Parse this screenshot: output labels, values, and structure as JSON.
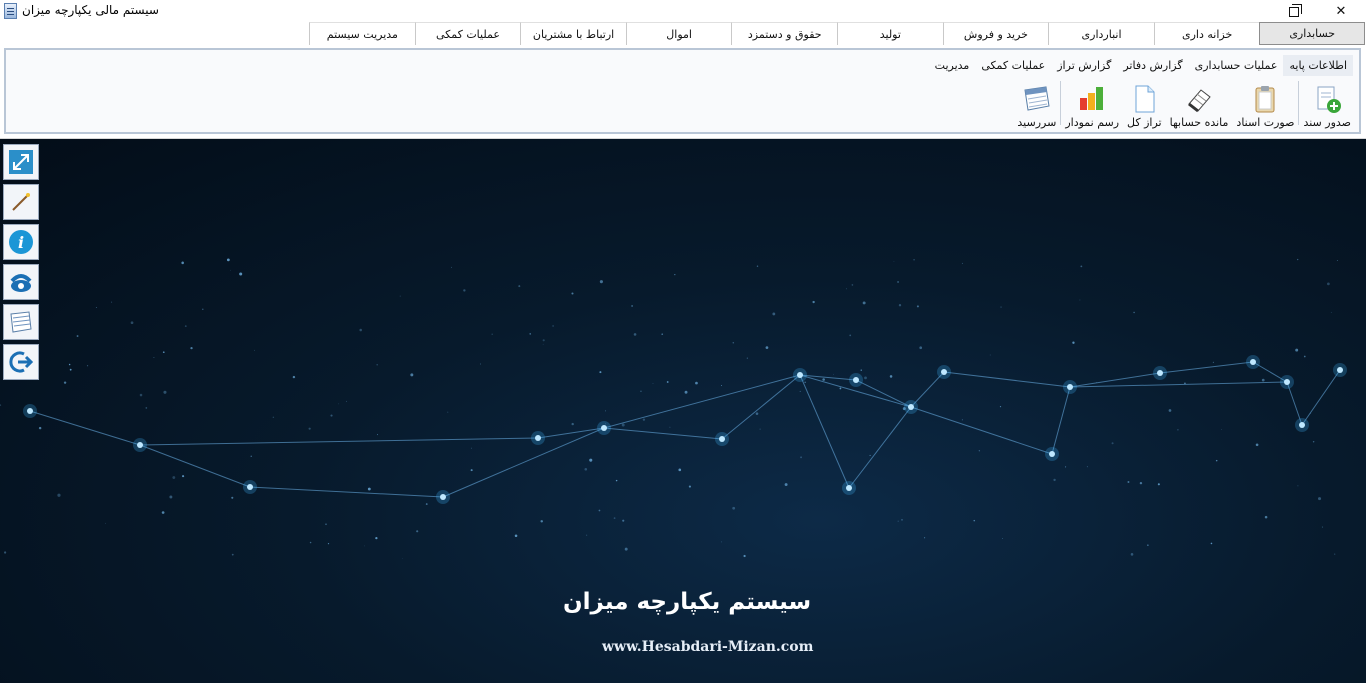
{
  "window": {
    "title": "سیستم مالی یکپارچه میزان"
  },
  "main_tabs": [
    {
      "label": "حسابداری",
      "active": true
    },
    {
      "label": "خزانه داری"
    },
    {
      "label": "انبارداری"
    },
    {
      "label": "خرید و فروش"
    },
    {
      "label": "تولید"
    },
    {
      "label": "حقوق و دستمزد"
    },
    {
      "label": "اموال"
    },
    {
      "label": "ارتباط با مشتریان"
    },
    {
      "label": "عملیات کمکی"
    },
    {
      "label": "مدیریت سیستم"
    }
  ],
  "sub_tabs": [
    {
      "label": "اطلاعات پایه",
      "active": true
    },
    {
      "label": "عملیات حسابداری"
    },
    {
      "label": "گزارش دفاتر"
    },
    {
      "label": "گزارش تراز"
    },
    {
      "label": "عملیات کمکی"
    },
    {
      "label": "مدیریت"
    }
  ],
  "tools": [
    {
      "label": "صدور سند",
      "icon": "document-add-icon"
    },
    {
      "label": "صورت اسناد",
      "icon": "clipboard-icon"
    },
    {
      "label": "مانده حسابها",
      "icon": "notebook-icon"
    },
    {
      "label": "تراز کل",
      "icon": "page-icon"
    },
    {
      "label": "رسم نمودار",
      "icon": "bar-chart-icon"
    },
    {
      "label": "سررسید",
      "icon": "calendar-icon"
    }
  ],
  "side_buttons": [
    "resize-icon",
    "magic-wand-icon",
    "info-icon",
    "phone-icon",
    "notes-icon",
    "logout-icon"
  ],
  "splash": {
    "title": "سیستم یکپارچه میزان",
    "url": "www.Hesabdari-Mizan.com"
  },
  "colors": {
    "background_dark": "#041220",
    "node_glow": "#3fb8ff",
    "ribbon_border": "#b9c6d6"
  }
}
